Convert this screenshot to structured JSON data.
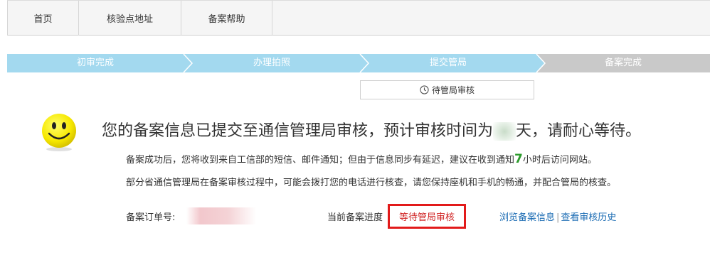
{
  "nav": {
    "tabs": [
      {
        "label": "首页"
      },
      {
        "label": "核验点地址"
      },
      {
        "label": "备案帮助"
      }
    ]
  },
  "steps": {
    "items": [
      {
        "label": "初审完成",
        "state": "done"
      },
      {
        "label": "办理拍照",
        "state": "done"
      },
      {
        "label": "提交管局",
        "state": "current"
      },
      {
        "label": "备案完成",
        "state": "pending"
      }
    ],
    "active_color": "#a3d9ef",
    "pending_color": "#c9c9c9",
    "current_status": "待管局审核"
  },
  "message": {
    "headline_before": "您的备案信息已提交至通信管理局审核，预计审核时间为",
    "headline_after": "天，请耐心等待。",
    "line1_before": "备案成功后，您将收到来自工信部的短信、邮件通知；但由于信息同步有延迟，建议在收到通知",
    "line1_hours": "7",
    "line1_after": "小时后访问网站。",
    "line2": "部分省通信管理局在备案审核过程中，可能会拨打您的电话进行核查，请您保持座机和手机的畅通，并配合管局的核查。"
  },
  "order": {
    "label": "备案订单号:",
    "progress_label": "当前备案进度",
    "progress_value": "等待管局审核",
    "highlight_color": "#e21a1a"
  },
  "links": {
    "browse": "浏览备案信息",
    "separator": "|",
    "history": "查看审核历史"
  },
  "icons": {
    "status": "clock-icon",
    "mood": "smiley-icon"
  }
}
